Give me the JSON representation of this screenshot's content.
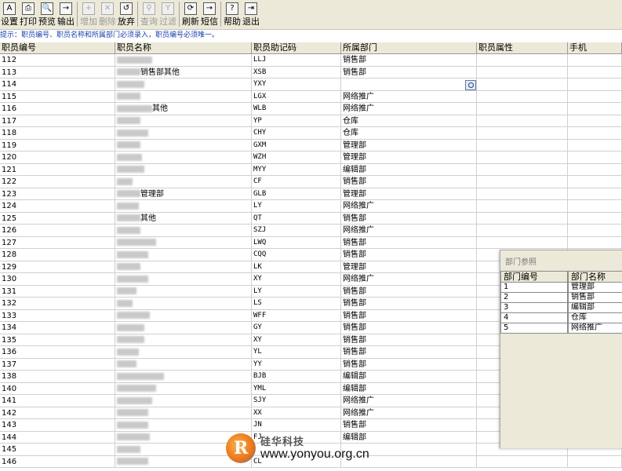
{
  "toolbar": {
    "buttons": [
      {
        "label": "设置",
        "glyph": "A"
      },
      {
        "label": "打印",
        "glyph": "⎙"
      },
      {
        "label": "预览",
        "glyph": "🔍"
      },
      {
        "label": "输出",
        "glyph": "→"
      },
      {
        "label": "增加",
        "glyph": "+",
        "disabled": true
      },
      {
        "label": "删除",
        "glyph": "✕",
        "disabled": true
      },
      {
        "label": "放弃",
        "glyph": "↺"
      },
      {
        "label": "查询",
        "glyph": "⚲",
        "disabled": true
      },
      {
        "label": "过滤",
        "glyph": "Y",
        "disabled": true
      },
      {
        "label": "刷新",
        "glyph": "⟳"
      },
      {
        "label": "短信",
        "glyph": "→"
      },
      {
        "label": "帮助",
        "glyph": "?"
      },
      {
        "label": "退出",
        "glyph": "⇥"
      }
    ]
  },
  "hint": "提示：职员编号、职员名称和所属部门必须录入，职员编号必须唯一。",
  "grid": {
    "columns": [
      "职员编号",
      "职员名称",
      "职员助记码",
      "所属部门",
      "职员属性",
      "手机"
    ],
    "rows": [
      {
        "id": "112",
        "name": "",
        "code": "LLJ",
        "dept": "销售部"
      },
      {
        "id": "113",
        "name": "销售部其他",
        "code": "XSB",
        "dept": "销售部"
      },
      {
        "id": "114",
        "name": "",
        "code": "YXY",
        "dept": ""
      },
      {
        "id": "115",
        "name": "",
        "code": "LGX",
        "dept": "网络推广"
      },
      {
        "id": "116",
        "name": "其他",
        "code": "WLB",
        "dept": "网络推广"
      },
      {
        "id": "117",
        "name": "",
        "code": "YP",
        "dept": "仓库"
      },
      {
        "id": "118",
        "name": "",
        "code": "CHY",
        "dept": "仓库"
      },
      {
        "id": "119",
        "name": "",
        "code": "GXM",
        "dept": "管理部"
      },
      {
        "id": "120",
        "name": "",
        "code": "WZH",
        "dept": "管理部"
      },
      {
        "id": "121",
        "name": "",
        "code": "MYY",
        "dept": "编辑部"
      },
      {
        "id": "122",
        "name": "",
        "code": "CF",
        "dept": "销售部"
      },
      {
        "id": "123",
        "name": "管理部",
        "code": "GLB",
        "dept": "管理部"
      },
      {
        "id": "124",
        "name": "",
        "code": "LY",
        "dept": "网络推广"
      },
      {
        "id": "125",
        "name": "其他",
        "code": "QT",
        "dept": "销售部"
      },
      {
        "id": "126",
        "name": "",
        "code": "SZJ",
        "dept": "网络推广"
      },
      {
        "id": "127",
        "name": "",
        "code": "LWQ",
        "dept": "销售部"
      },
      {
        "id": "128",
        "name": "",
        "code": "CQQ",
        "dept": "销售部"
      },
      {
        "id": "129",
        "name": "",
        "code": "LK",
        "dept": "管理部"
      },
      {
        "id": "130",
        "name": "",
        "code": "XY",
        "dept": "网络推广"
      },
      {
        "id": "131",
        "name": "",
        "code": "LY",
        "dept": "销售部"
      },
      {
        "id": "132",
        "name": "",
        "code": "LS",
        "dept": "销售部"
      },
      {
        "id": "133",
        "name": "",
        "code": "WFF",
        "dept": "销售部"
      },
      {
        "id": "134",
        "name": "",
        "code": "GY",
        "dept": "销售部"
      },
      {
        "id": "135",
        "name": "",
        "code": "XY",
        "dept": "销售部"
      },
      {
        "id": "136",
        "name": "",
        "code": "YL",
        "dept": "销售部"
      },
      {
        "id": "137",
        "name": "",
        "code": "YY",
        "dept": "销售部"
      },
      {
        "id": "138",
        "name": "",
        "code": "BJB",
        "dept": "编辑部"
      },
      {
        "id": "140",
        "name": "",
        "code": "YML",
        "dept": "编辑部"
      },
      {
        "id": "141",
        "name": "",
        "code": "SJY",
        "dept": "网络推广"
      },
      {
        "id": "142",
        "name": "",
        "code": "XX",
        "dept": "网络推广"
      },
      {
        "id": "143",
        "name": "",
        "code": "JN",
        "dept": "销售部"
      },
      {
        "id": "144",
        "name": "",
        "code": "FJ",
        "dept": "编辑部"
      },
      {
        "id": "145",
        "name": "",
        "code": "",
        "dept": ""
      },
      {
        "id": "146",
        "name": "",
        "code": "CL",
        "dept": ""
      }
    ]
  },
  "dept_panel": {
    "title": "部门参照",
    "columns": [
      "部门编号",
      "部门名称"
    ],
    "rows": [
      {
        "id": "1",
        "name": "管理部"
      },
      {
        "id": "2",
        "name": "销售部"
      },
      {
        "id": "3",
        "name": "编辑部"
      },
      {
        "id": "4",
        "name": "仓库"
      },
      {
        "id": "5",
        "name": "网络推广"
      }
    ]
  },
  "watermark": {
    "cn": "硅华科技",
    "url": "www.yonyou.org.cn"
  }
}
